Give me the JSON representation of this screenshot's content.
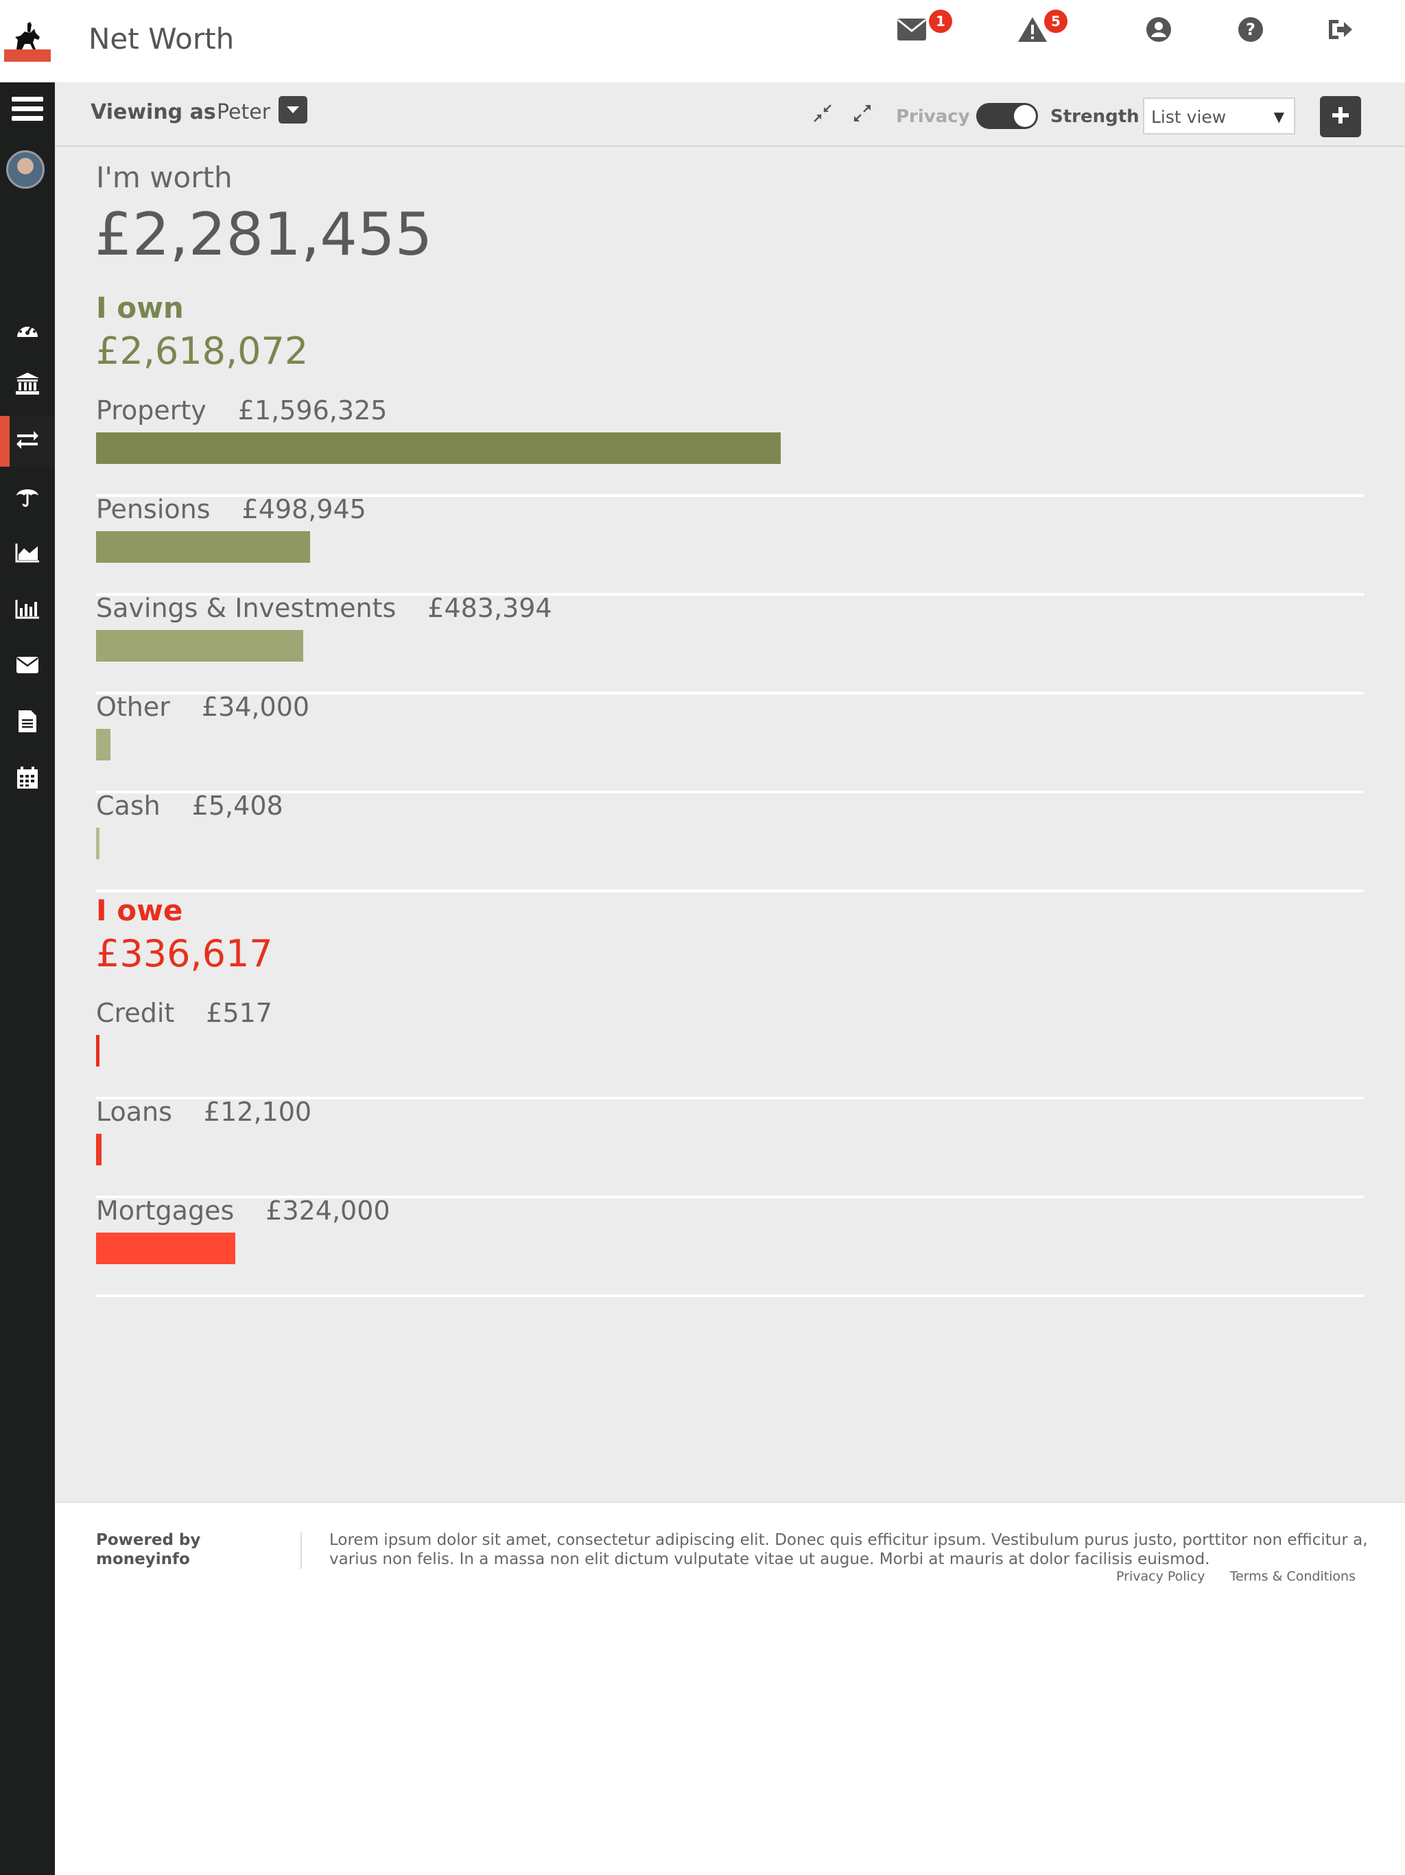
{
  "header": {
    "title": "Net Worth",
    "messages_badge": "1",
    "alerts_badge": "5",
    "icons": [
      "logo-horse-rider-icon",
      "envelope-icon",
      "warning-icon",
      "user-icon",
      "help-icon",
      "logout-icon"
    ]
  },
  "sidebar": {
    "items": [
      {
        "name": "menu",
        "icon": "hamburger-icon"
      },
      {
        "name": "dashboard",
        "icon": "dashboard-icon"
      },
      {
        "name": "accounts",
        "icon": "bank-icon"
      },
      {
        "name": "net-worth",
        "icon": "transfer-icon",
        "active": true
      },
      {
        "name": "protection",
        "icon": "umbrella-icon"
      },
      {
        "name": "area-chart",
        "icon": "area-chart-icon"
      },
      {
        "name": "bar-chart",
        "icon": "bar-chart-icon"
      },
      {
        "name": "messages",
        "icon": "envelope-icon"
      },
      {
        "name": "documents",
        "icon": "document-icon"
      },
      {
        "name": "calendar",
        "icon": "calendar-icon"
      }
    ]
  },
  "toolbar": {
    "viewing_as_label": "Viewing as",
    "viewing_as_name": "Peter",
    "privacy_label": "Privacy",
    "privacy_on": true,
    "strength_label": "Strength",
    "view_select_value": "List view"
  },
  "summary": {
    "worth_label": "I'm worth",
    "worth_value": "£2,281,455",
    "own_heading": "I own",
    "own_total": "£2,618,072",
    "owe_heading": "I owe",
    "owe_total": "£336,617"
  },
  "own_items": [
    {
      "label": "Property",
      "amount": "£1,596,325",
      "value": 1596325,
      "color": "#7f8751"
    },
    {
      "label": "Pensions",
      "amount": "£498,945",
      "value": 498945,
      "color": "#8f9862"
    },
    {
      "label": "Savings & Investments",
      "amount": "£483,394",
      "value": 483394,
      "color": "#9ea673"
    },
    {
      "label": "Other",
      "amount": "£34,000",
      "value": 34000,
      "color": "#a8b07f"
    },
    {
      "label": "Cash",
      "amount": "£5,408",
      "value": 5408,
      "color": "#b5bb91"
    }
  ],
  "owe_items": [
    {
      "label": "Credit",
      "amount": "£517",
      "value": 517,
      "color": "#e8301e"
    },
    {
      "label": "Loans",
      "amount": "£12,100",
      "value": 12100,
      "color": "#ef3a25"
    },
    {
      "label": "Mortgages",
      "amount": "£324,000",
      "value": 324000,
      "color": "#ff4733"
    }
  ],
  "footer": {
    "powered_by": "Powered by moneyinfo",
    "text": "Lorem ipsum dolor sit amet, consectetur adipiscing elit. Donec quis efficitur ipsum. Vestibulum purus justo, porttitor non efficitur a, varius non felis. In a massa non elit dictum vulputate vitae ut augue. Morbi at mauris at dolor facilisis euismod.",
    "privacy_link": "Privacy Policy",
    "terms_link": "Terms & Conditions"
  }
}
